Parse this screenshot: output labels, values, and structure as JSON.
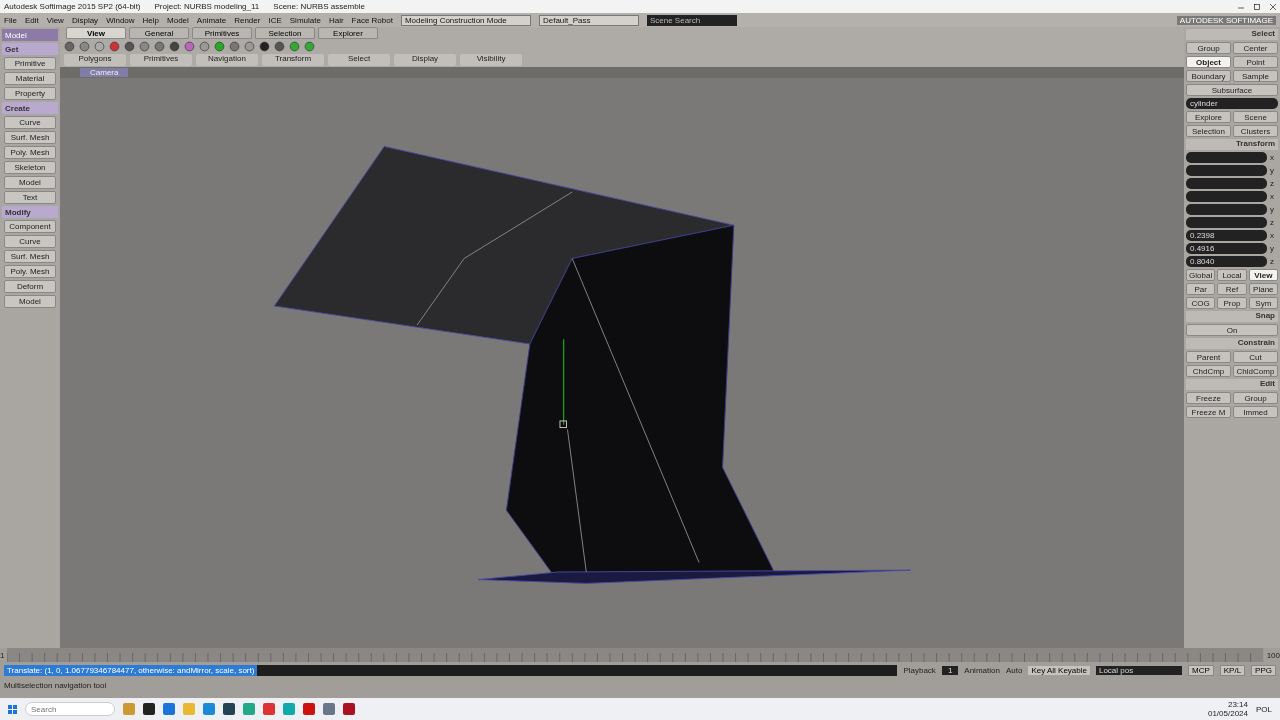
{
  "window": {
    "title": "Autodesk Softimage 2015 SP2 (64-bit)",
    "project": "Project: NURBS modeling_11",
    "scene": "Scene: NURBS assemble"
  },
  "menu": [
    "File",
    "Edit",
    "View",
    "Display",
    "Window",
    "Help",
    "Model",
    "Animate",
    "Render",
    "ICE",
    "Simulate",
    "Hair",
    "Face Robot"
  ],
  "mode_dropdown": "Modeling Construction Mode",
  "pass_dropdown": "Default_Pass",
  "search": {
    "placeholder": "Scene Search"
  },
  "toolbar_tabs": [
    {
      "label": "View",
      "selected": true
    },
    {
      "label": "General",
      "selected": false
    },
    {
      "label": "Primitives",
      "selected": false
    },
    {
      "label": "Selection",
      "selected": false
    },
    {
      "label": "Explorer",
      "selected": false
    }
  ],
  "toolbar_groups": [
    "Polygons",
    "Primitives",
    "Navigation",
    "Transform",
    "Select",
    "Display",
    "Visibility"
  ],
  "left_panel": {
    "mode": "Model",
    "sections": [
      {
        "title": "Get",
        "buttons": [
          "Primitive",
          "Material",
          "Property"
        ]
      },
      {
        "title": "Create",
        "buttons": [
          "Curve",
          "Surf. Mesh",
          "Poly. Mesh",
          "Skeleton",
          "Model",
          "Text"
        ]
      },
      {
        "title": "Modify",
        "buttons": [
          "Component",
          "Curve",
          "Surf. Mesh",
          "Poly. Mesh",
          "Deform",
          "Model"
        ]
      }
    ]
  },
  "viewport": {
    "camera": "Camera"
  },
  "right_panel": {
    "brand": "AUTODESK SOFTIMAGE",
    "select_title": "Select",
    "select_buttons": [
      {
        "label": "Group",
        "selected": false
      },
      {
        "label": "Center",
        "selected": false
      },
      {
        "label": "Object",
        "selected": true
      },
      {
        "label": "Point",
        "selected": false
      },
      {
        "label": "Boundary",
        "selected": false
      },
      {
        "label": "Sample",
        "selected": false
      }
    ],
    "subsurface": "Subsurface",
    "object_name": "cylinder",
    "explore_buttons": [
      "Explore",
      "Scene",
      "Selection",
      "Clusters"
    ],
    "transform_title": "Transform",
    "transform_rows": [
      {
        "axis": "x"
      },
      {
        "axis": "y"
      },
      {
        "axis": "z"
      },
      {
        "axis": "x"
      },
      {
        "axis": "y"
      },
      {
        "axis": "z"
      },
      {
        "axis": "x",
        "value": "0.2398"
      },
      {
        "axis": "y",
        "value": "0.4916"
      },
      {
        "axis": "z",
        "value": "0.8040"
      }
    ],
    "space_buttons": [
      {
        "label": "Global",
        "selected": false
      },
      {
        "label": "Local",
        "selected": false
      },
      {
        "label": "View",
        "selected": true
      },
      {
        "label": "Par",
        "selected": false
      },
      {
        "label": "Ref",
        "selected": false
      },
      {
        "label": "Plane",
        "selected": false
      },
      {
        "label": "COG",
        "selected": false
      },
      {
        "label": "Prop",
        "selected": false
      },
      {
        "label": "Sym",
        "selected": false
      }
    ],
    "snap_title": "Snap",
    "snap_toggle": "On",
    "constrain_title": "Constrain",
    "constrain_buttons": [
      "Parent",
      "Cut",
      "ChdCmp",
      "ChldComp"
    ],
    "edit_title": "Edit",
    "edit_buttons": [
      "Freeze",
      "Group",
      "Freeze M",
      "Immed"
    ]
  },
  "timeline": {
    "start": "1",
    "end": "100"
  },
  "command_line": "Translate: (1, 0, 1.06779346784477, otherwise: andMirror, scale, sort)",
  "playback": {
    "label": "Playback",
    "frame": "1",
    "animation": "Animation",
    "auto": "Auto",
    "key_set": "Key All Keyable",
    "key_field": "Local pos"
  },
  "panel_tabs": [
    "MCP",
    "KP/L",
    "PPG"
  ],
  "status": "Multiselection navigation tool",
  "taskbar": {
    "search": {
      "placeholder": "Search"
    },
    "time": "23:14",
    "date": "01/05/2024",
    "lang": "POL"
  }
}
